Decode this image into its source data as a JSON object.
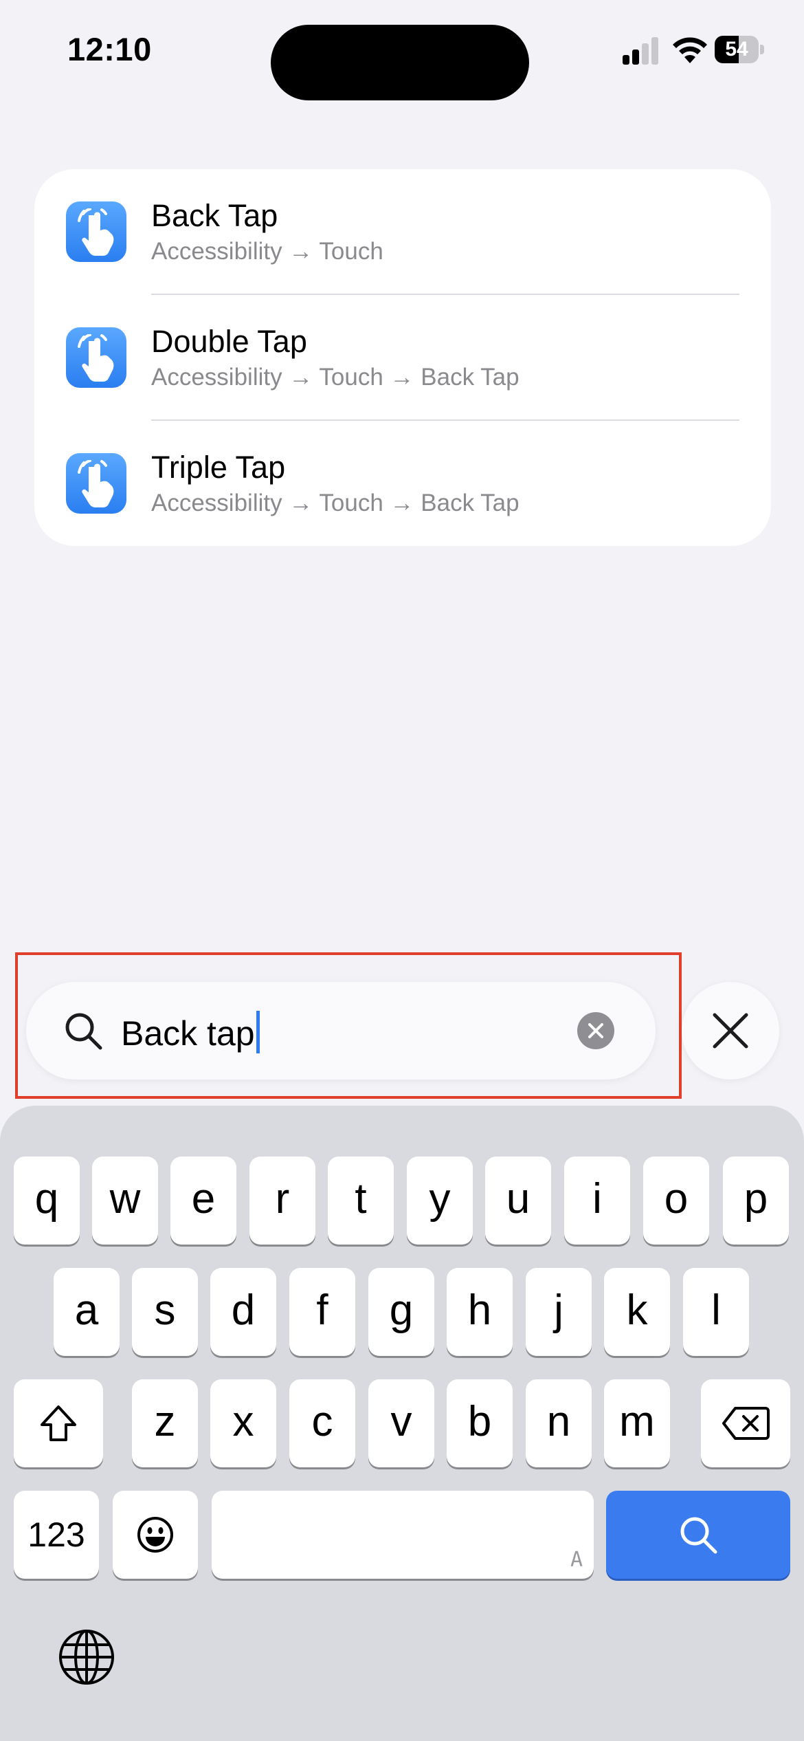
{
  "status_bar": {
    "time": "12:10",
    "battery": "54",
    "battery_fraction": 0.54
  },
  "results": [
    {
      "title": "Back Tap",
      "path": "Accessibility → Touch",
      "icon": "accessibility-touch-icon"
    },
    {
      "title": "Double Tap",
      "path": "Accessibility → Touch → Back Tap",
      "icon": "accessibility-touch-icon"
    },
    {
      "title": "Triple Tap",
      "path": "Accessibility → Touch → Back Tap",
      "icon": "accessibility-touch-icon"
    }
  ],
  "search": {
    "value": "Back tap",
    "icon": "search-icon",
    "clear_icon": "clear-circle-icon",
    "cancel_icon": "close-icon"
  },
  "keyboard": {
    "row1": [
      "q",
      "w",
      "e",
      "r",
      "t",
      "y",
      "u",
      "i",
      "o",
      "p"
    ],
    "row2": [
      "a",
      "s",
      "d",
      "f",
      "g",
      "h",
      "j",
      "k",
      "l"
    ],
    "row3": [
      "z",
      "x",
      "c",
      "v",
      "b",
      "n",
      "m"
    ],
    "numbers_label": "123",
    "space_hint": "A",
    "emoji_icon": "emoji-icon",
    "shift_icon": "shift-icon",
    "delete_icon": "delete-icon",
    "search_key_icon": "search-icon",
    "globe_icon": "globe-icon"
  },
  "colors": {
    "background": "#f2f2f7",
    "accent": "#3a7cf0",
    "highlight": "#e0402b",
    "keyboard": "#d9dae0"
  }
}
